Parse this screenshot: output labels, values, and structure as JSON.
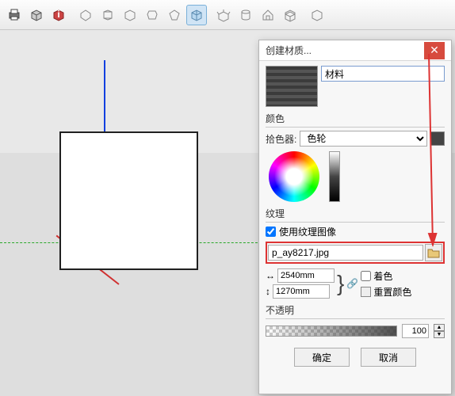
{
  "toolbar_icons": [
    "printer",
    "box",
    "info",
    "blank",
    "diamond",
    "hexagon",
    "pentagon",
    "home",
    "slab",
    "shade",
    "blank",
    "box-open",
    "cylinder",
    "house",
    "chest",
    "blank",
    "cube"
  ],
  "dialog": {
    "title": "创建材质...",
    "material_name": "材料",
    "color_label": "颜色",
    "picker_label": "拾色器:",
    "picker_value": "色轮",
    "texture_label": "纹理",
    "use_texture_image": "使用纹理图像",
    "texture_file": "p_ay8217.jpg",
    "width_value": "2540mm",
    "height_value": "1270mm",
    "colorize_label": "着色",
    "reset_color_label": "重置颜色",
    "opacity_label": "不透明",
    "opacity_value": "100",
    "ok": "确定",
    "cancel": "取消"
  }
}
